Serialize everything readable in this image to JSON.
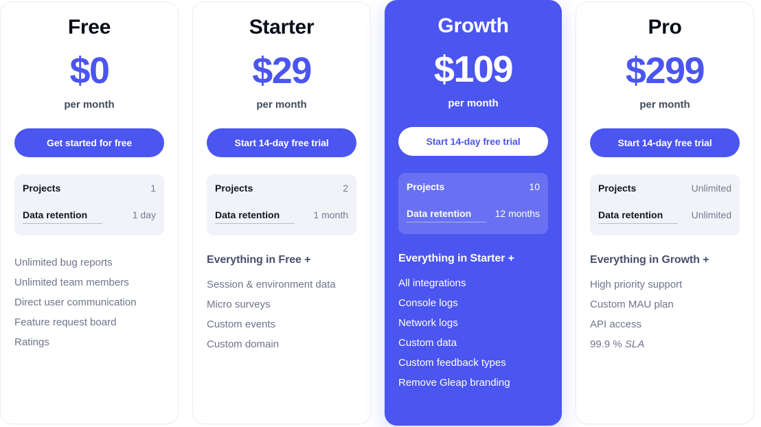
{
  "colors": {
    "accent": "#4b55f0",
    "card_bg": "#ffffff",
    "featured_bg": "#4b55f0",
    "spec_box_bg": "#f1f3f9",
    "title": "#0b0d1a",
    "muted_text": "#6e7489"
  },
  "plans": [
    {
      "id": "free",
      "name": "Free",
      "price": "$0",
      "period": "per month",
      "cta_label": "Get started for free",
      "featured": false,
      "specs": [
        {
          "label": "Projects",
          "value": "1",
          "tooltip": false
        },
        {
          "label": "Data retention",
          "value": "1 day",
          "tooltip": true
        }
      ],
      "features_heading": "",
      "features": [
        "Unlimited bug reports",
        "Unlimited team members",
        "Direct user communication",
        "Feature request board",
        "Ratings"
      ]
    },
    {
      "id": "starter",
      "name": "Starter",
      "price": "$29",
      "period": "per month",
      "cta_label": "Start 14-day free trial",
      "featured": false,
      "specs": [
        {
          "label": "Projects",
          "value": "2",
          "tooltip": false
        },
        {
          "label": "Data retention",
          "value": "1 month",
          "tooltip": true
        }
      ],
      "features_heading": "Everything in Free +",
      "features": [
        "Session & environment data",
        "Micro surveys",
        "Custom events",
        "Custom domain"
      ]
    },
    {
      "id": "growth",
      "name": "Growth",
      "price": "$109",
      "period": "per month",
      "cta_label": "Start 14-day free trial",
      "featured": true,
      "specs": [
        {
          "label": "Projects",
          "value": "10",
          "tooltip": false
        },
        {
          "label": "Data retention",
          "value": "12 months",
          "tooltip": true
        }
      ],
      "features_heading": "Everything in Starter +",
      "features": [
        "All integrations",
        "Console logs",
        "Network logs",
        "Custom data",
        "Custom feedback types",
        "Remove Gleap branding"
      ]
    },
    {
      "id": "pro",
      "name": "Pro",
      "price": "$299",
      "period": "per month",
      "cta_label": "Start 14-day free trial",
      "featured": false,
      "specs": [
        {
          "label": "Projects",
          "value": "Unlimited",
          "tooltip": false
        },
        {
          "label": "Data retention",
          "value": "Unlimited",
          "tooltip": true
        }
      ],
      "features_heading": "Everything in Growth +",
      "features": [
        "High priority support",
        "Custom MAU plan",
        "API access",
        "99.9 % SLA"
      ],
      "features_italic_tail": {
        "index": 3,
        "plain": "99.9 % ",
        "italic": "SLA"
      }
    }
  ]
}
